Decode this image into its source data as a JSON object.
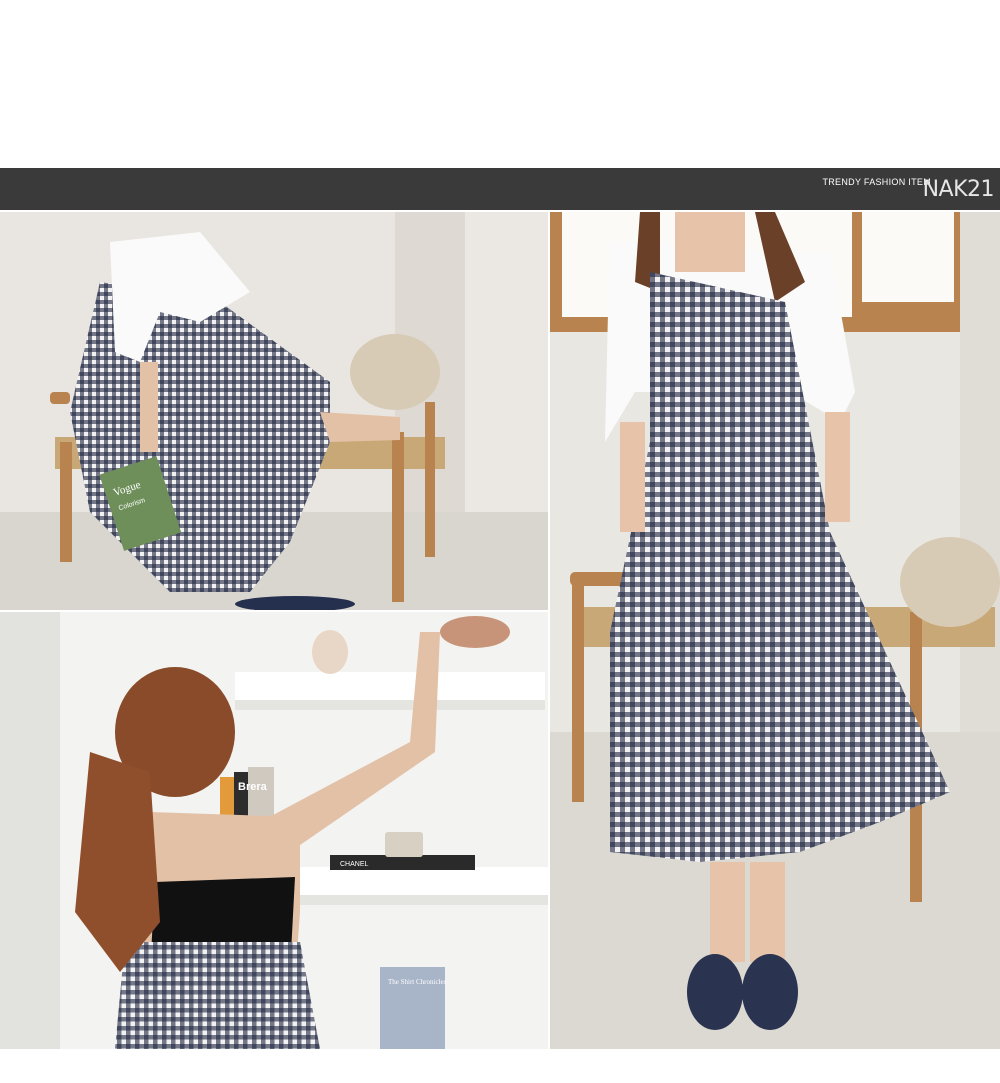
{
  "banner": {
    "tagline": "TRENDY FASHION ITEM",
    "brand": "NAK21",
    "background": "#3a3a3a"
  },
  "photos": {
    "seated": {
      "book_lines": [
        "Vogue",
        "Colorism"
      ]
    },
    "shelf": {
      "book_spine": "Brera",
      "tray_label": "CHANEL",
      "magazine": "The Shirt Chronicles"
    },
    "standing": {}
  },
  "colors": {
    "gingham_dark": "#1e2540",
    "gingham_light": "#f2f2f2",
    "wood": "#b9834f",
    "wall": "#e9e6e1"
  }
}
